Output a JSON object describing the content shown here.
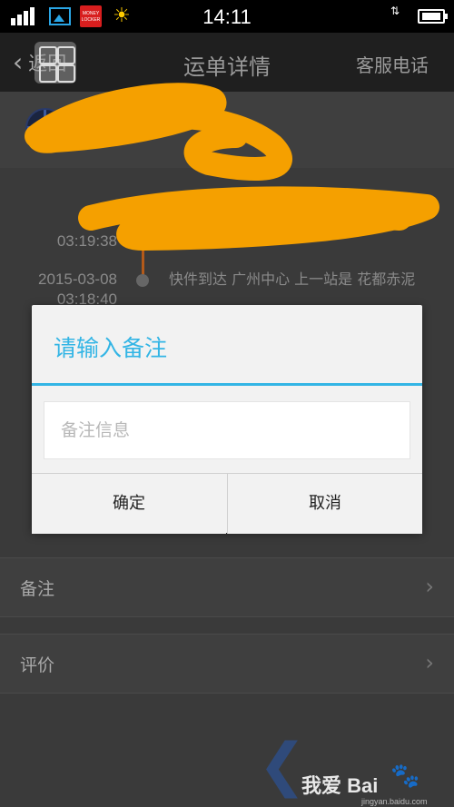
{
  "status_bar": {
    "time": "14:11",
    "money_icon_text": "MONEY LOCKER",
    "icons": [
      "signal-icon",
      "image-icon",
      "money-locker-icon",
      "sun-icon",
      "signal2-icon",
      "battery-icon"
    ]
  },
  "header": {
    "back_label": "返回",
    "title": "运单详情",
    "customer_service_label": "客服电话"
  },
  "timeline": {
    "entries": [
      {
        "date": "",
        "time": "03:19:38",
        "text": ""
      },
      {
        "date": "2015-03-08",
        "time": "03:18:40",
        "text": "快件到达 广州中心 上一站是 花都赤泥"
      }
    ]
  },
  "rows": {
    "remark_label": "备注",
    "review_label": "评价"
  },
  "dialog": {
    "title": "请输入备注",
    "input_placeholder": "备注信息",
    "input_value": "",
    "confirm_label": "确定",
    "cancel_label": "取消"
  },
  "watermark": {
    "text": "我爱 Bai",
    "url": "jingyan.baidu.com"
  },
  "colors": {
    "accent": "#33b5e5",
    "scribble": "#f5a000"
  }
}
